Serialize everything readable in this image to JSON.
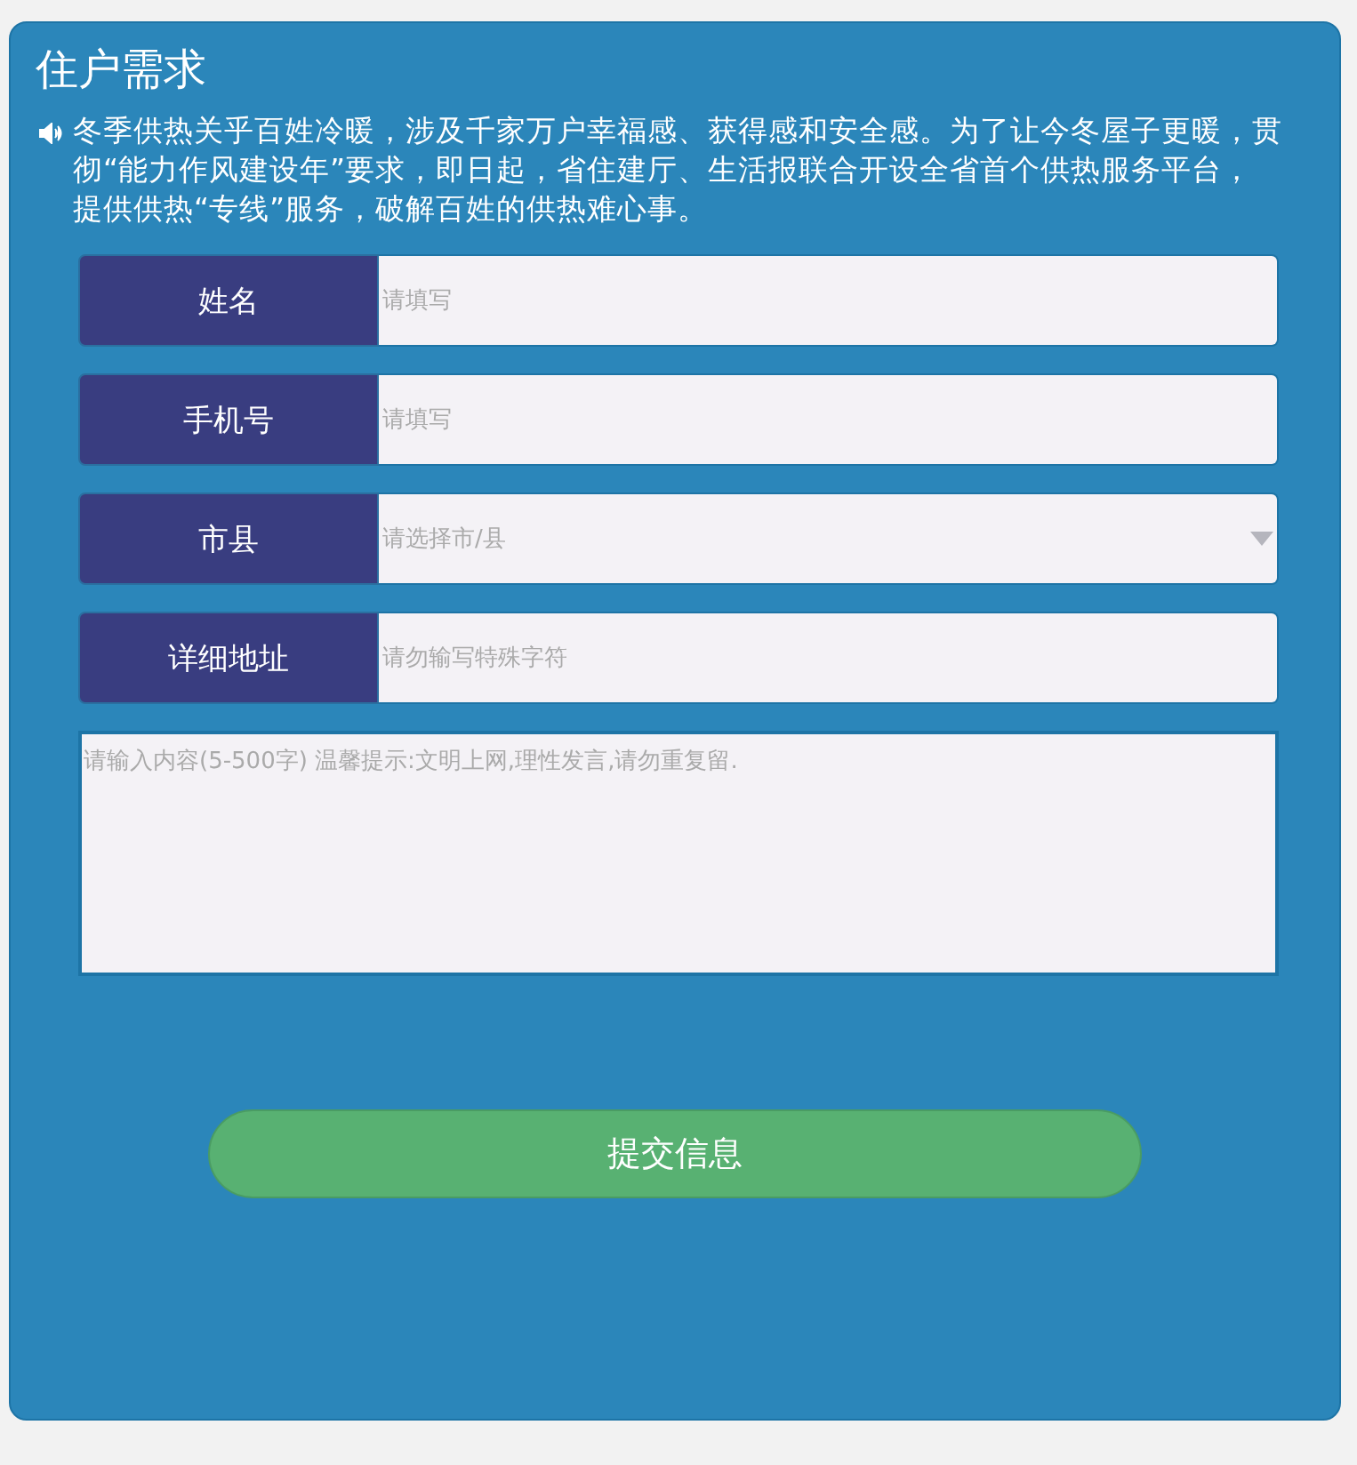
{
  "title": "住户需求",
  "notice": "冬季供热关乎百姓冷暖，涉及千家万户幸福感、获得感和安全感。为了让今冬屋子更暖，贯彻“能力作风建设年”要求，即日起，省住建厅、生活报联合开设全省首个供热服务平台，提供供热“专线”服务，破解百姓的供热难心事。",
  "fields": [
    {
      "kind": "text",
      "label": "姓名",
      "placeholder": "请填写"
    },
    {
      "kind": "text",
      "label": "手机号",
      "placeholder": "请填写"
    },
    {
      "kind": "select",
      "label": "市县",
      "placeholder": "请选择市/县"
    },
    {
      "kind": "text",
      "label": "详细地址",
      "placeholder": "请勿输写特殊字符"
    }
  ],
  "message": {
    "placeholder": "请输入内容(5-500字) 温馨提示:文明上网,理性发言,请勿重复留."
  },
  "submit": "提交信息"
}
